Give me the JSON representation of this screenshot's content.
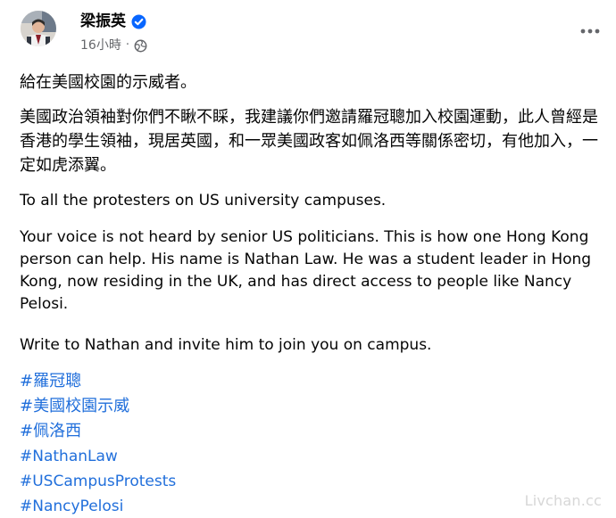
{
  "post": {
    "author": {
      "name": "梁振英",
      "verified": true
    },
    "time_label": "16小時",
    "dot": "·",
    "visibility_icon": "globe-icon",
    "menu_icon": "ellipsis-icon",
    "paragraphs": {
      "zh_intro": "給在美國校園的示威者。",
      "zh_body": "美國政治領袖對你們不瞅不睬，我建議你們邀請羅冠聰加入校園運動，此人曾經是香港的學生領袖，現居英國，和一眾美國政客如佩洛西等關係密切，有他加入，一定如虎添翼。",
      "en_intro": "To all the protesters on US university campuses.",
      "en_body": "Your voice is not heard by senior US politicians. This is how one Hong Kong person can help. His name is Nathan Law. He was a student leader in Hong Kong, now residing in the UK, and has direct access to people like Nancy Pelosi.",
      "en_cta": "Write to Nathan and invite him to join you on campus."
    },
    "hashtags": [
      "#羅冠聰",
      "#美國校園示威",
      "#佩洛西",
      "#NathanLaw",
      "#USCampusProtests",
      "#NancyPelosi"
    ]
  },
  "watermark": "Livchan.cc",
  "colors": {
    "text": "#050505",
    "meta": "#65676b",
    "link": "#216fdb",
    "verified": "#0866ff"
  }
}
